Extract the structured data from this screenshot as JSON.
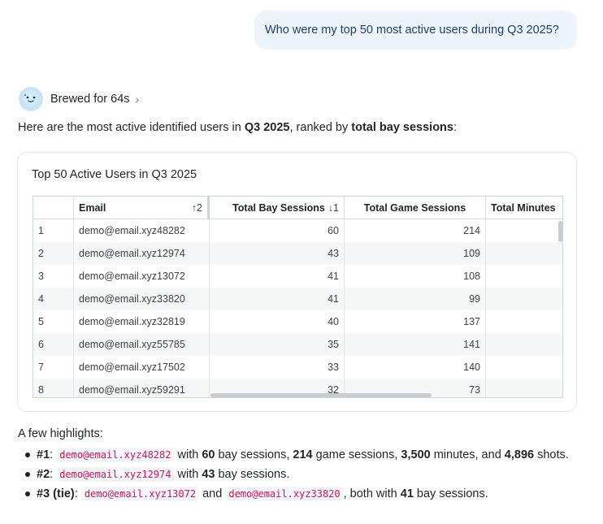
{
  "user_message": "Who were my top 50 most active users during Q3 2025?",
  "assistant": {
    "status_label": "Brewed for 64s",
    "chevron": "›",
    "intro": {
      "prefix": "Here are the most active identified users in ",
      "period": "Q3 2025",
      "middle": ", ranked by ",
      "metric": "total bay sessions",
      "suffix": ":"
    }
  },
  "table": {
    "title": "Top 50 Active Users in Q3 2025",
    "columns": [
      {
        "label": "",
        "sort": ""
      },
      {
        "label": "Email",
        "sort": "↑2"
      },
      {
        "label": "Total Bay Sessions",
        "sort": "↓1"
      },
      {
        "label": "Total Game Sessions",
        "sort": ""
      },
      {
        "label": "Total Minutes",
        "sort": ""
      }
    ],
    "rows": [
      {
        "idx": "1",
        "email": "demo@email.xyz48282",
        "bay": "60",
        "game": "214"
      },
      {
        "idx": "2",
        "email": "demo@email.xyz12974",
        "bay": "43",
        "game": "109"
      },
      {
        "idx": "3",
        "email": "demo@email.xyz13072",
        "bay": "41",
        "game": "108"
      },
      {
        "idx": "4",
        "email": "demo@email.xyz33820",
        "bay": "41",
        "game": "99"
      },
      {
        "idx": "5",
        "email": "demo@email.xyz32819",
        "bay": "40",
        "game": "137"
      },
      {
        "idx": "6",
        "email": "demo@email.xyz55785",
        "bay": "35",
        "game": "141"
      },
      {
        "idx": "7",
        "email": "demo@email.xyz17502",
        "bay": "33",
        "game": "140"
      },
      {
        "idx": "8",
        "email": "demo@email.xyz59291",
        "bay": "32",
        "game": "73"
      }
    ]
  },
  "highlights": {
    "title": "A few highlights:",
    "b1": {
      "rank": "#1",
      "sep": ": ",
      "email": "demo@email.xyz48282",
      "t1": " with ",
      "v1": "60",
      "t2": " bay sessions, ",
      "v2": "214",
      "t3": " game sessions, ",
      "v3": "3,500",
      "t4": " minutes, and ",
      "v4": "4,896",
      "t5": " shots."
    },
    "b2": {
      "rank": "#2",
      "sep": ": ",
      "email": "demo@email.xyz12974",
      "t1": " with ",
      "v1": "43",
      "t2": " bay sessions."
    },
    "b3": {
      "rank": "#3 (tie)",
      "sep": ": ",
      "email1": "demo@email.xyz13072",
      "and": " and ",
      "email2": "demo@email.xyz33820",
      "t1": ", both with ",
      "v1": "41",
      "t2": " bay sessions."
    }
  }
}
